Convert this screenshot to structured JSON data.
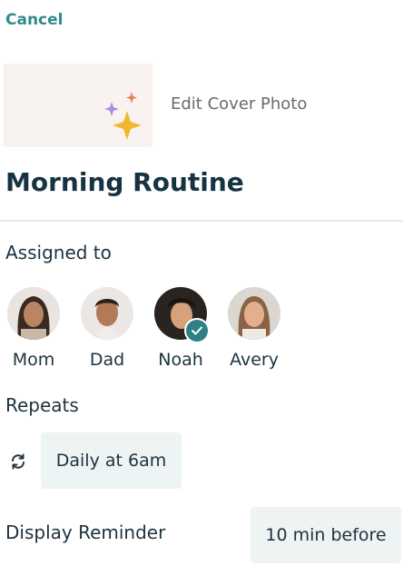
{
  "header": {
    "cancel_label": "Cancel"
  },
  "cover": {
    "edit_label": "Edit Cover Photo",
    "icon": "sparkles-icon"
  },
  "routine": {
    "title": "Morning Routine"
  },
  "assigned": {
    "label": "Assigned to",
    "members": [
      {
        "name": "Mom",
        "selected": false
      },
      {
        "name": "Dad",
        "selected": false
      },
      {
        "name": "Noah",
        "selected": true
      },
      {
        "name": "Avery",
        "selected": false
      }
    ]
  },
  "repeats": {
    "label": "Repeats",
    "value": "Daily at 6am",
    "icon": "repeat-icon"
  },
  "reminder": {
    "label": "Display Reminder",
    "value": "10 min before"
  },
  "colors": {
    "accent": "#2f8b8b",
    "badge": "#2f7f86",
    "chip_bg": "#eef3f3",
    "title": "#173342"
  }
}
